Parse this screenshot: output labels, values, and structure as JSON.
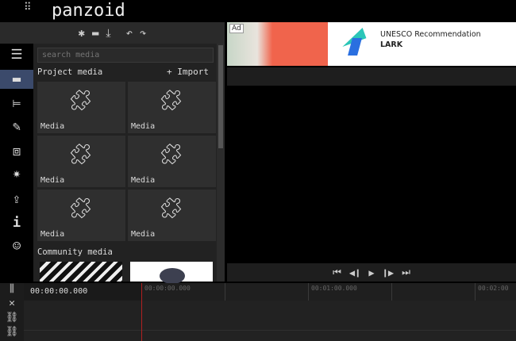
{
  "app": {
    "logo": "panzoid",
    "menu_icon": "grid-icon"
  },
  "toolbar": {
    "icons": [
      "asterisk-icon",
      "folder-icon",
      "download-icon",
      "undo-icon",
      "redo-icon"
    ]
  },
  "sidenav": {
    "items": [
      {
        "name": "menu",
        "icon": "☰"
      },
      {
        "name": "media",
        "icon": "▬",
        "selected": true
      },
      {
        "name": "timeline",
        "icon": "⊨"
      },
      {
        "name": "edit",
        "icon": "✎"
      },
      {
        "name": "3d",
        "icon": "⧈"
      },
      {
        "name": "effects",
        "icon": "✷"
      },
      {
        "name": "export",
        "icon": "⇪"
      },
      {
        "name": "info",
        "icon": "i"
      },
      {
        "name": "emoji",
        "icon": "☺"
      }
    ]
  },
  "media": {
    "search_placeholder": "search media",
    "project_label": "Project media",
    "import_label": "+ Import",
    "tiles": [
      "Media",
      "Media",
      "Media",
      "Media",
      "Media",
      "Media"
    ],
    "community_label": "Community media"
  },
  "ad": {
    "badge": "Ad",
    "title": "UNESCO Recommendation",
    "brand": "LARK",
    "accent": "#f0644c"
  },
  "timeline": {
    "current_time": "00:00:00.000",
    "ticks": [
      "00:00:00.000",
      "00:01:00.000",
      "00:02:00"
    ]
  }
}
